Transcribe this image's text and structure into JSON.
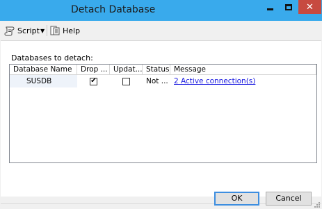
{
  "window": {
    "title": "Detach Database"
  },
  "toolbar": {
    "script_label": "Script",
    "help_label": "Help"
  },
  "section": {
    "label": "Databases to detach:"
  },
  "grid": {
    "headers": [
      "Database Name",
      "Drop ...",
      "Updat...",
      "Status",
      "Message"
    ],
    "rows": [
      {
        "database_name": "SUSDB",
        "drop_connections": true,
        "update_statistics": false,
        "status": "Not ...",
        "message": "2 Active connection(s)"
      }
    ]
  },
  "buttons": {
    "ok": "OK",
    "cancel": "Cancel"
  },
  "colors": {
    "titlebar": "#39aaec",
    "close": "#c74a40",
    "link": "#1a1ae0"
  },
  "icons": [
    "minimize-icon",
    "maximize-icon",
    "close-icon",
    "script-icon",
    "dropdown-arrow-icon",
    "help-icon",
    "checkbox-checked",
    "checkbox-unchecked",
    "resize-grip-icon"
  ]
}
